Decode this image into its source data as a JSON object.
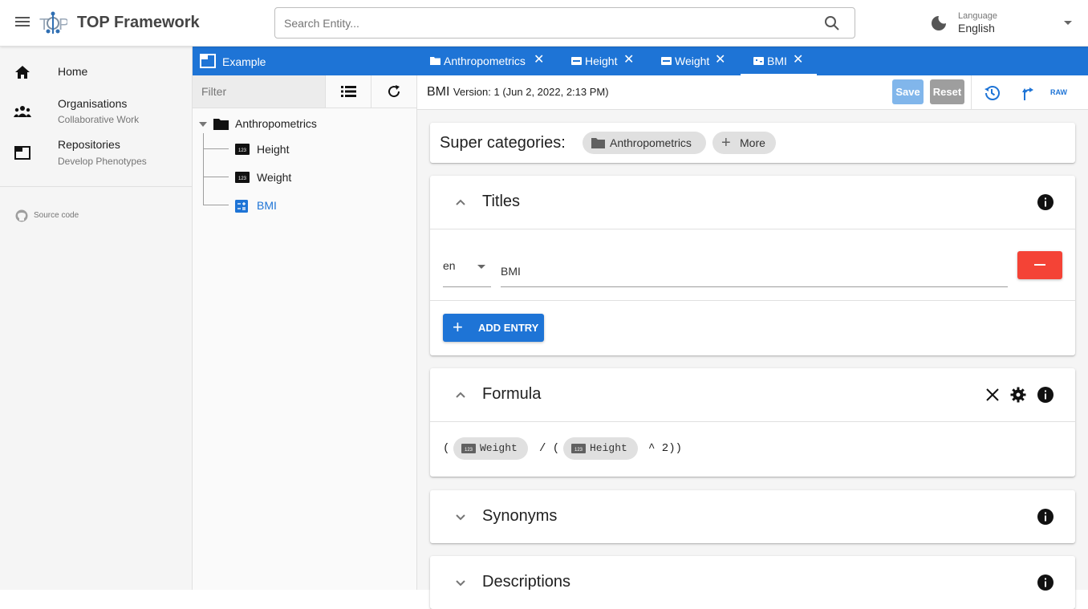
{
  "header": {
    "app_title": "TOP Framework",
    "search_placeholder": "Search Entity...",
    "language_label": "Language",
    "language_value": "English"
  },
  "leftnav": {
    "items": [
      {
        "label": "Home",
        "sub": ""
      },
      {
        "label": "Organisations",
        "sub": "Collaborative Work"
      },
      {
        "label": "Repositories",
        "sub": "Develop Phenotypes"
      }
    ],
    "source_label": "Source code"
  },
  "tree": {
    "repo_name": "Example",
    "filter_placeholder": "Filter",
    "root": "Anthropometrics",
    "children": [
      "Height",
      "Weight",
      "BMI"
    ],
    "selected": "BMI"
  },
  "tabs": [
    {
      "label": "Anthropometrics"
    },
    {
      "label": "Height"
    },
    {
      "label": "Weight"
    },
    {
      "label": "BMI",
      "active": true
    }
  ],
  "entity": {
    "name": "BMI",
    "version": "Version: 1 (Jun 2, 2022, 2:13 PM)",
    "save_label": "Save",
    "reset_label": "Reset",
    "raw_label": "RAW"
  },
  "super_categories": {
    "label": "Super categories:",
    "chips": [
      "Anthropometrics"
    ],
    "more_label": "More"
  },
  "titles": {
    "heading": "Titles",
    "entries": [
      {
        "lang": "en",
        "value": "BMI"
      }
    ],
    "add_label": "ADD ENTRY"
  },
  "formula": {
    "heading": "Formula",
    "open1": "(",
    "var1": "Weight",
    "op": "/ (",
    "var2": "Height",
    "tail": "^ 2))"
  },
  "synonyms": {
    "heading": "Synonyms"
  },
  "descriptions": {
    "heading": "Descriptions"
  },
  "colors": {
    "primary": "#1e74d6",
    "danger": "#f44336",
    "save_disabled": "#81b6eb",
    "reset_disabled": "#9e9e9e"
  }
}
